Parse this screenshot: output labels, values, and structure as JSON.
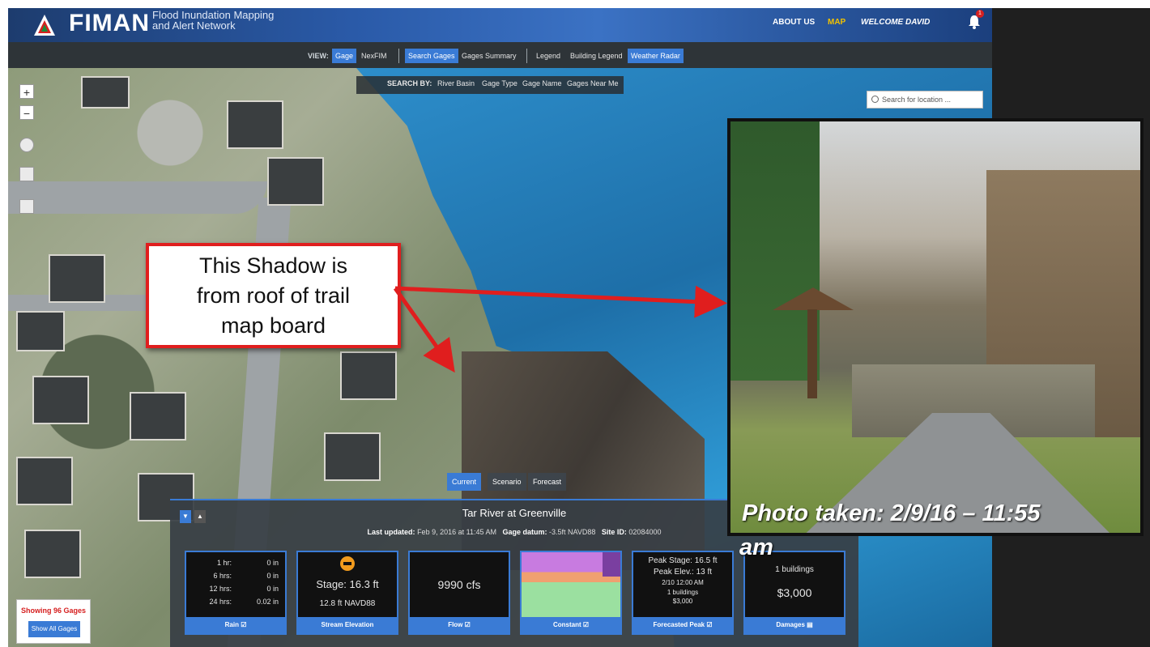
{
  "header": {
    "brand": "FIMAN",
    "subtitle_line1": "Flood Inundation Mapping",
    "subtitle_line2": "and Alert Network",
    "about": "ABOUT US",
    "map": "MAP",
    "welcome": "WELCOME DAVID",
    "notifications": "1"
  },
  "toolbar": {
    "view_label": "VIEW:",
    "gage": "Gage",
    "nexfim": "NexFIM",
    "search_gages": "Search Gages",
    "gages_summary": "Gages Summary",
    "legend": "Legend",
    "building_legend": "Building Legend",
    "weather_radar": "Weather Radar"
  },
  "search_by": {
    "label": "SEARCH BY:",
    "items": [
      "River Basin",
      "Gage Type",
      "Gage Name",
      "Gages Near Me"
    ]
  },
  "location_search": {
    "placeholder": "Search for location ..."
  },
  "map_controls": {
    "zoom_in": "+",
    "zoom_out": "−"
  },
  "callout": {
    "line1": "This Shadow is",
    "line2": "from roof of trail",
    "line3": "map board"
  },
  "photo": {
    "caption": "Photo taken:  2/9/16 – 11:55",
    "caption_overflow": "am"
  },
  "tabs": [
    "Current",
    "Scenario",
    "Forecast"
  ],
  "gage": {
    "title": "Tar River at Greenville",
    "last_updated_label": "Last updated:",
    "last_updated": "Feb 9, 2016 at 11:45 AM",
    "datum_label": "Gage datum:",
    "datum": "-3.5ft NAVD88",
    "site_label": "Site ID:",
    "site_id": "02084000"
  },
  "cards": {
    "rain": {
      "rows": [
        {
          "k": "1 hr:",
          "v": "0 in"
        },
        {
          "k": "6 hrs:",
          "v": "0 in"
        },
        {
          "k": "12 hrs:",
          "v": "0 in"
        },
        {
          "k": "24 hrs:",
          "v": "0.02 in"
        }
      ],
      "footer": "Rain"
    },
    "stream": {
      "stage": "Stage: 16.3 ft",
      "elev": "12.8 ft NAVD88",
      "footer": "Stream Elevation"
    },
    "flow": {
      "value": "9990 cfs",
      "footer": "Flow"
    },
    "constant": {
      "footer": "Constant"
    },
    "peak": {
      "stage": "Peak Stage: 16.5 ft",
      "elev": "Peak Elev.: 13 ft",
      "time": "2/10 12:00 AM",
      "buildings": "1 buildings",
      "damage": "$3,000",
      "footer": "Forecasted Peak"
    },
    "damages": {
      "buildings": "1 buildings",
      "amount": "$3,000",
      "footer": "Damages"
    }
  },
  "showing": {
    "text": "Showing 96 Gages",
    "button": "Show All Gages"
  },
  "colors": {
    "accent": "#3a7bd5",
    "map_link": "#f2c200",
    "callout_border": "#e01e1e",
    "flood": "#2d8ecb"
  }
}
